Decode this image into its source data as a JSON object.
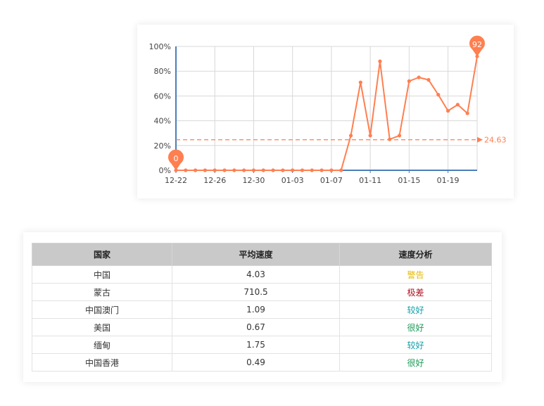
{
  "chart_data": {
    "type": "line",
    "x": [
      "12-22",
      "12-23",
      "12-24",
      "12-25",
      "12-26",
      "12-27",
      "12-28",
      "12-29",
      "12-30",
      "12-31",
      "01-01",
      "01-02",
      "01-03",
      "01-04",
      "01-05",
      "01-06",
      "01-07",
      "01-08",
      "01-09",
      "01-10",
      "01-11",
      "01-12",
      "01-13",
      "01-14",
      "01-15",
      "01-16",
      "01-17",
      "01-18",
      "01-19",
      "01-20",
      "01-21",
      "01-22"
    ],
    "series": [
      {
        "values": [
          0,
          0,
          0,
          0,
          0,
          0,
          0,
          0,
          0,
          0,
          0,
          0,
          0,
          0,
          0,
          0,
          0,
          0,
          28,
          71,
          28,
          88,
          25,
          28,
          72,
          75,
          73,
          61,
          48,
          53,
          46,
          92
        ]
      }
    ],
    "xticks": [
      "12-22",
      "12-26",
      "12-30",
      "01-03",
      "01-07",
      "01-11",
      "01-15",
      "01-19"
    ],
    "yticks": [
      "0%",
      "20%",
      "40%",
      "60%",
      "80%",
      "100%"
    ],
    "ylim": [
      0,
      100
    ],
    "y_unit": "%",
    "average_line": {
      "value": 24.63,
      "label": "24.63"
    },
    "markers": [
      {
        "label": "0",
        "index": 0
      },
      {
        "label": "92",
        "index": 31
      }
    ],
    "grid": true,
    "colors": {
      "line": "#ff7f50",
      "axis": "#4a7eb8",
      "grid": "#d8d8d8"
    }
  },
  "table": {
    "headers": [
      "国家",
      "平均速度",
      "速度分析"
    ],
    "rows": [
      {
        "country": "中国",
        "speed": "4.03",
        "analysis": "警告",
        "color": "#e6b800"
      },
      {
        "country": "蒙古",
        "speed": "710.5",
        "analysis": "极差",
        "color": "#b01020"
      },
      {
        "country": "中国澳门",
        "speed": "1.09",
        "analysis": "较好",
        "color": "#16a0a8"
      },
      {
        "country": "美国",
        "speed": "0.67",
        "analysis": "很好",
        "color": "#1a9a55"
      },
      {
        "country": "缅甸",
        "speed": "1.75",
        "analysis": "较好",
        "color": "#16a0a8"
      },
      {
        "country": "中国香港",
        "speed": "0.49",
        "analysis": "很好",
        "color": "#1a9a55"
      }
    ]
  }
}
